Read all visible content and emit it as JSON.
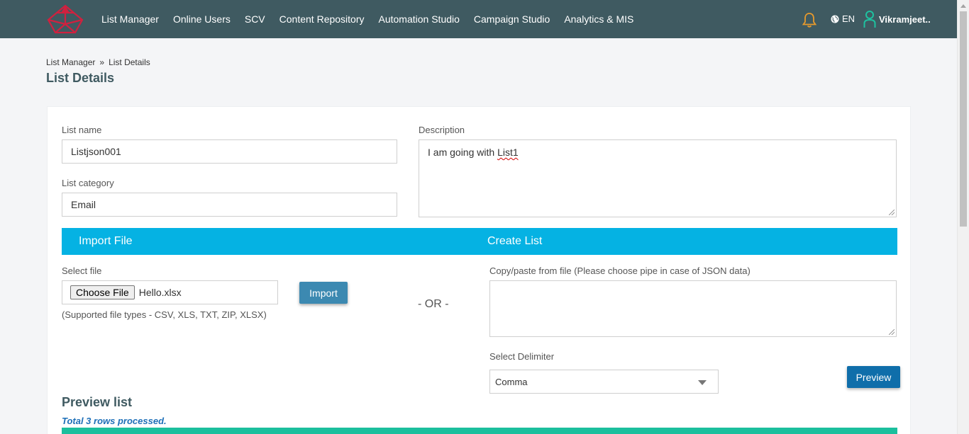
{
  "colors": {
    "topbar": "#3f5a61",
    "accent_blue": "#05b2e3",
    "button_blue": "#3c89b1",
    "button_dark": "#0f6eaa",
    "teal": "#1bbf9d",
    "bell": "#e89a2c",
    "user_icon": "#1ec2a0"
  },
  "header": {
    "nav": [
      "List Manager",
      "Online Users",
      "SCV",
      "Content Repository",
      "Automation Studio",
      "Campaign Studio",
      "Analytics & MIS"
    ],
    "language": "EN",
    "user_name": "Vikramjeet.."
  },
  "breadcrumb": {
    "parent": "List Manager",
    "separator": "»",
    "current": "List Details"
  },
  "page_title": "List Details",
  "form": {
    "list_name_label": "List name",
    "list_name_value": "Listjson001",
    "list_category_label": "List category",
    "list_category_value": "Email",
    "description_label": "Description",
    "description_text_before": "I am going with ",
    "description_text_misspelled": "List1"
  },
  "import_section": {
    "import_header": "Import File",
    "create_header": "Create List",
    "select_file_label": "Select file",
    "choose_file_button": "Choose File",
    "file_name": "Hello.xlsx",
    "import_button": "Import",
    "supported_types": "(Supported file types - CSV, XLS, TXT, ZIP, XLSX)",
    "or_text": "- OR -",
    "copy_paste_label": "Copy/paste from file (Please choose pipe in case of JSON data)",
    "copy_paste_value": "",
    "delimiter_label": "Select Delimiter",
    "delimiter_value": "Comma",
    "preview_button": "Preview"
  },
  "preview": {
    "title": "Preview list",
    "rows_processed": "Total 3 rows processed."
  },
  "icons": [
    "logo-icon",
    "bell-icon",
    "globe-icon",
    "user-icon",
    "chevron-down-icon"
  ]
}
